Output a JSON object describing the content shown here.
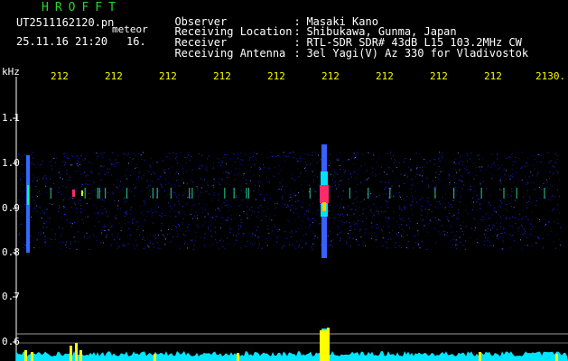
{
  "header": {
    "brand": "HROFFT",
    "filename": "UT2511162120.pn",
    "meteor_label": "meteor",
    "datetime": "25.11.16 21:20",
    "count": "16.",
    "info": [
      {
        "label": "Observer",
        "value": "Masaki Kano"
      },
      {
        "label": "Receiving Location",
        "value": "Shibukawa, Gunma, Japan"
      },
      {
        "label": "Receiver",
        "value": "RTL-SDR SDR# 43dB L15 103.2MHz CW"
      },
      {
        "label": "Receiving Antenna",
        "value": "3el Yagi(V) Az 330 for Vladivostok"
      }
    ]
  },
  "axes": {
    "y_unit": "kHz",
    "x_labels": [
      "212",
      "212",
      "212",
      "212",
      "212",
      "212",
      "212",
      "212",
      "212",
      "2130."
    ],
    "y_labels": [
      "1.1",
      "1.0",
      "0.9",
      "0.8",
      "0.7",
      "0.6"
    ]
  },
  "colors": {
    "background": "#000000",
    "brand": "#29d629",
    "axis_label": "#ffff00",
    "noise": "#1a2cff",
    "echo": "#ff2a6a",
    "spectrum_fill": "#00e5ff",
    "spectrum_peak": "#ffff00"
  }
}
